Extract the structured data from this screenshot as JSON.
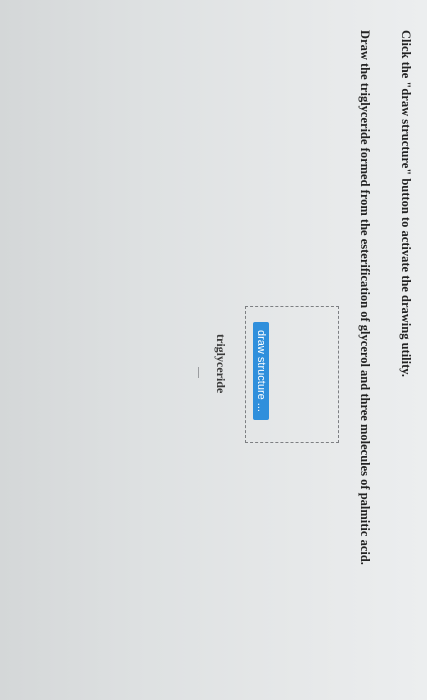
{
  "instructions": {
    "line1": "Click the \"draw structure\" button to activate the drawing utility.",
    "line2": "Draw the triglyceride formed from the esterification of glycerol and three molecules of palmitic acid."
  },
  "drawing": {
    "button_label": "draw structure ...",
    "caption": "triglyceride"
  },
  "colors": {
    "button_bg": "#2f8fdc",
    "button_text": "#ffffff",
    "text": "#232323"
  }
}
